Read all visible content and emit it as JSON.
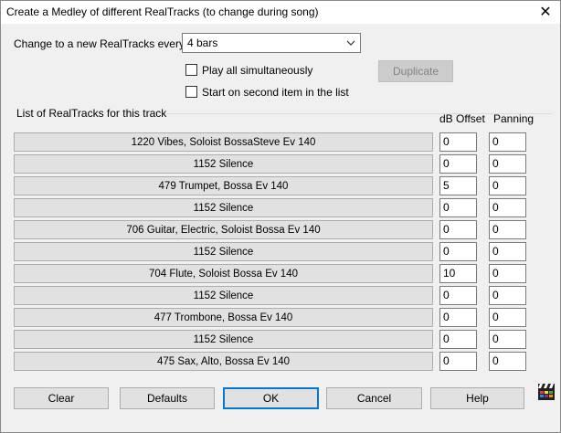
{
  "window": {
    "title": "Create a Medley of different RealTracks (to change during song)"
  },
  "change_label": "Change to a new RealTracks every",
  "interval": {
    "value": "4 bars"
  },
  "options": {
    "play_all": {
      "label": "Play all simultaneously",
      "checked": false
    },
    "start_second": {
      "label": "Start on second item in the list",
      "checked": false
    }
  },
  "duplicate_label": "Duplicate",
  "list_label": "List of RealTracks for this track",
  "columns": {
    "db_offset": "dB Offset",
    "panning": "Panning"
  },
  "tracks": [
    {
      "name": "1220 Vibes, Soloist BossaSteve Ev 140",
      "db": "0",
      "pan": "0"
    },
    {
      "name": "1152 Silence",
      "db": "0",
      "pan": "0"
    },
    {
      "name": "479 Trumpet, Bossa Ev 140",
      "db": "5",
      "pan": "0"
    },
    {
      "name": "1152 Silence",
      "db": "0",
      "pan": "0"
    },
    {
      "name": "706 Guitar, Electric, Soloist Bossa Ev 140",
      "db": "0",
      "pan": "0"
    },
    {
      "name": "1152 Silence",
      "db": "0",
      "pan": "0"
    },
    {
      "name": "704 Flute, Soloist Bossa Ev 140",
      "db": "10",
      "pan": "0"
    },
    {
      "name": "1152 Silence",
      "db": "0",
      "pan": "0"
    },
    {
      "name": "477 Trombone, Bossa Ev 140",
      "db": "0",
      "pan": "0"
    },
    {
      "name": "1152 Silence",
      "db": "0",
      "pan": "0"
    },
    {
      "name": "475 Sax, Alto, Bossa Ev 140",
      "db": "0",
      "pan": "0"
    }
  ],
  "buttons": {
    "clear": "Clear",
    "defaults": "Defaults",
    "ok": "OK",
    "cancel": "Cancel",
    "help": "Help"
  },
  "icons": {
    "close": "close-icon",
    "dropdown": "chevron-down-icon",
    "clapboard": "clapboard-icon"
  }
}
